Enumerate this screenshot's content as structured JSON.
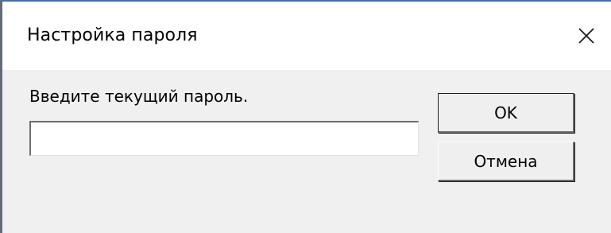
{
  "window": {
    "title": "Настройка пароля",
    "close_icon": "close-icon"
  },
  "form": {
    "prompt": "Введите текущий пароль.",
    "password_value": "",
    "password_placeholder": ""
  },
  "buttons": {
    "ok_label": "OK",
    "cancel_label": "Отмена"
  },
  "colors": {
    "accent": "#3f6fae",
    "dialog_bg": "#f0f0f0",
    "titlebar_bg": "#ffffff"
  }
}
